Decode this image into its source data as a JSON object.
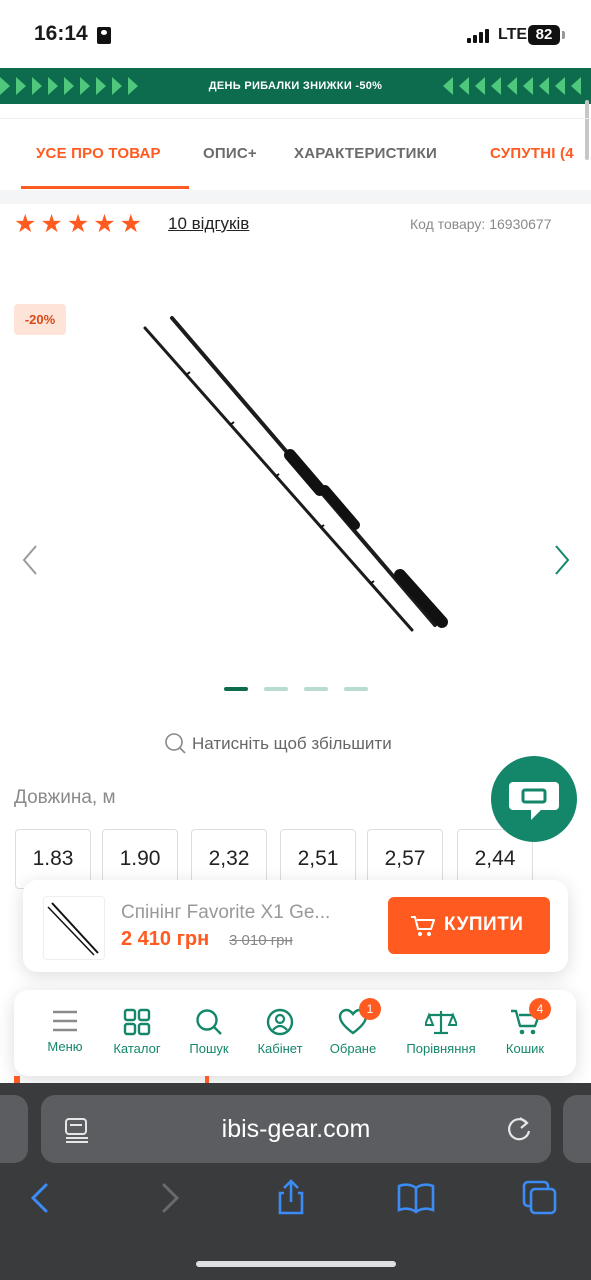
{
  "status_bar": {
    "time": "16:14",
    "network": "LTE",
    "battery": "82"
  },
  "promo": {
    "text": "ДЕНЬ РИБАЛКИ ЗНИЖКИ -50%",
    "bg_color": "#0d6b4e",
    "accent_color": "#4fc77d"
  },
  "tabs": [
    {
      "label": "УСЕ ПРО ТОВАР",
      "active": true
    },
    {
      "label": "ОПИС+"
    },
    {
      "label": "ХАРАКТЕРИСТИКИ"
    },
    {
      "label": "СУПУТНІ (4"
    }
  ],
  "rating": {
    "stars": 5,
    "stars_text": "★★★★★",
    "reviews": "10 відгуків",
    "sku": "Код товару: 16930677"
  },
  "gallery": {
    "discount": "-20%",
    "slides": 4,
    "active_slide": 1,
    "zoom_hint": "Натисніть щоб збільшити",
    "image_icon": "fishing-rod"
  },
  "options": {
    "label": "Довжина, м",
    "lengths": [
      "1.83",
      "1.90",
      "2,32",
      "2,51",
      "2,57",
      "2,44"
    ]
  },
  "product": {
    "name": "Спінінг Favorite X1 Ge...",
    "price": "2 410 грн",
    "old_price": "3 010 грн",
    "buy_label": "КУПИТИ"
  },
  "nav": {
    "menu": "Меню",
    "catalog": "Каталог",
    "search": "Пошук",
    "account": "Кабінет",
    "favorites": "Обране",
    "favorites_badge": "1",
    "compare": "Порівняння",
    "cart": "Кошик",
    "cart_badge": "4"
  },
  "browser": {
    "url": "ibis-gear.com"
  },
  "colors": {
    "accent": "#ff5a1f",
    "brand": "#14876a"
  }
}
